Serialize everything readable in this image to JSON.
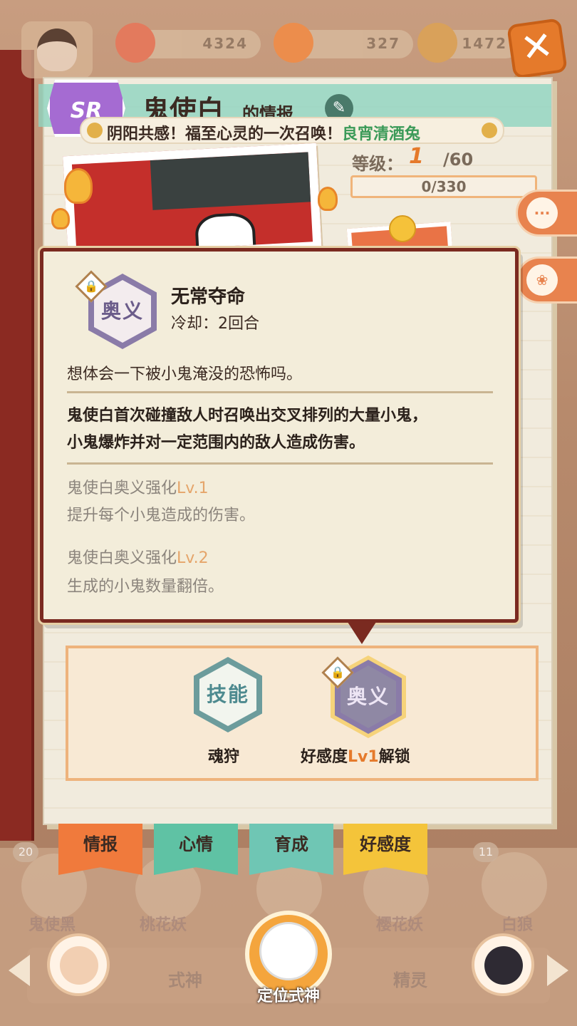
{
  "topbar": {
    "currency_1": "4324",
    "currency_2": "327",
    "currency_3": "1472",
    "close_icon": "close-x"
  },
  "header": {
    "rarity": "SR",
    "name": "鬼使白",
    "title_suffix": "的情报",
    "marquee_prefix": "阴阳共感！福至心灵的一次召唤！",
    "marquee_highlight": "良宵清酒兔"
  },
  "level": {
    "label": "等级：",
    "current": "1",
    "max": "/60",
    "exp_text": "0/330",
    "exp_fraction": 0
  },
  "skill_popup": {
    "icon_label": "奥义",
    "name": "无常夺命",
    "cooldown": "冷却：2回合",
    "flavor": "想体会一下被小鬼淹没的恐怖吗。",
    "effect_line1": "鬼使白首次碰撞敌人时召唤出交叉排列的大量小鬼，",
    "effect_line2": "小鬼爆炸并对一定范围内的敌人造成伤害。",
    "upgrades": [
      {
        "title": "鬼使白奥义强化",
        "level": "Lv.1",
        "desc": "提升每个小鬼造成的伤害。"
      },
      {
        "title": "鬼使白奥义强化",
        "level": "Lv.2",
        "desc": "生成的小鬼数量翻倍。"
      }
    ]
  },
  "skills": [
    {
      "icon_label": "技能",
      "label": "魂狩"
    },
    {
      "icon_label": "奥义",
      "label_prefix": "好感度",
      "label_level": "Lv1",
      "label_suffix": "解锁"
    }
  ],
  "tabs": [
    {
      "label": "情报",
      "color": "#f07a3c"
    },
    {
      "label": "心情",
      "color": "#5fc2a4"
    },
    {
      "label": "育成",
      "color": "#6fc6b4"
    },
    {
      "label": "好感度",
      "color": "#f4c43a"
    }
  ],
  "roster": [
    {
      "name": "鬼使黑",
      "badge": "20"
    },
    {
      "name": "桃花妖",
      "badge": ""
    },
    {
      "name": "",
      "badge": ""
    },
    {
      "name": "樱花妖",
      "badge": ""
    },
    {
      "name": "白狼",
      "badge": "11"
    }
  ],
  "bottom": {
    "left_label": "式神",
    "right_label": "精灵",
    "locate_label": "定位式神"
  }
}
